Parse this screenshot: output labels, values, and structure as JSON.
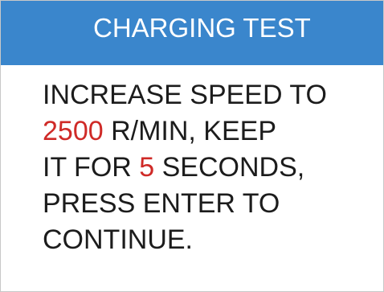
{
  "header": {
    "title": "CHARGING TEST"
  },
  "message": {
    "line1": "INCREASE SPEED TO",
    "line2_value": "2500",
    "line2_text": " R/MIN, KEEP",
    "line3_prefix": "IT FOR ",
    "line3_value": "5",
    "line3_suffix": " SECONDS,",
    "line4": "PRESS ENTER TO",
    "line5": "CONTINUE."
  },
  "colors": {
    "title_bar": "#3a86cc",
    "highlight": "#cf2a27",
    "text": "#1c1c1c"
  }
}
